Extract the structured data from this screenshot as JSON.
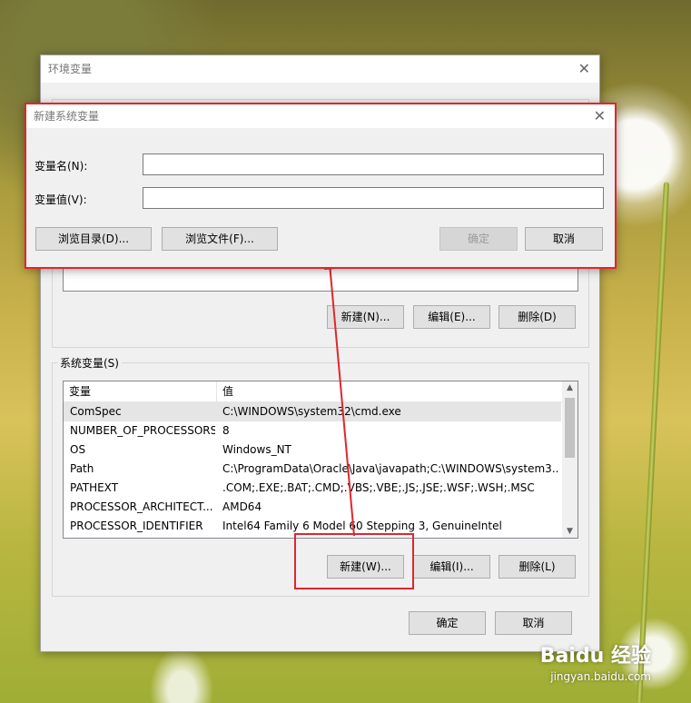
{
  "env_window": {
    "title": "环境变量",
    "new_user_label": "新建(N)...",
    "edit_user_label": "编辑(E)...",
    "delete_user_label": "删除(D)",
    "system_group_label": "系统变量(S)",
    "columns": [
      "变量",
      "值"
    ],
    "rows": [
      {
        "name": "ComSpec",
        "value": "C:\\WINDOWS\\system32\\cmd.exe"
      },
      {
        "name": "NUMBER_OF_PROCESSORS",
        "value": "8"
      },
      {
        "name": "OS",
        "value": "Windows_NT"
      },
      {
        "name": "Path",
        "value": "C:\\ProgramData\\Oracle\\Java\\javapath;C:\\WINDOWS\\system3..."
      },
      {
        "name": "PATHEXT",
        "value": ".COM;.EXE;.BAT;.CMD;.VBS;.VBE;.JS;.JSE;.WSF;.WSH;.MSC"
      },
      {
        "name": "PROCESSOR_ARCHITECT...",
        "value": "AMD64"
      },
      {
        "name": "PROCESSOR_IDENTIFIER",
        "value": "Intel64 Family 6 Model 60 Stepping 3, GenuineIntel"
      }
    ],
    "new_system_label": "新建(W)...",
    "edit_system_label": "编辑(I)...",
    "delete_system_label": "删除(L)",
    "ok_label": "确定",
    "cancel_label": "取消"
  },
  "new_var_dialog": {
    "title": "新建系统变量",
    "name_label": "变量名(N):",
    "name_value": "",
    "value_label": "变量值(V):",
    "value_value": "",
    "browse_dir_label": "浏览目录(D)...",
    "browse_file_label": "浏览文件(F)...",
    "ok_label": "确定",
    "cancel_label": "取消"
  },
  "watermark": {
    "brand": "Baidu 经验",
    "url": "jingyan.baidu.com"
  },
  "colors": {
    "highlight": "#e0262d"
  }
}
